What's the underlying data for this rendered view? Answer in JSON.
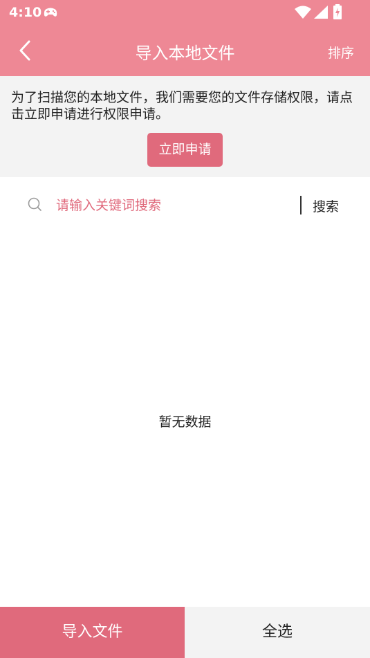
{
  "status_bar": {
    "time": "4:10",
    "icons": [
      "gamepad-icon",
      "wifi-icon",
      "signal-icon",
      "battery-icon"
    ]
  },
  "header": {
    "title": "导入本地文件",
    "sort_label": "排序",
    "back_icon": "chevron-left-icon"
  },
  "permission": {
    "message": "为了扫描您的本地文件，我们需要您的文件存储权限，请点击立即申请进行权限申请。",
    "button_label": "立即申请"
  },
  "search": {
    "placeholder": "请输入关键词搜索",
    "value": "",
    "button_label": "搜索",
    "icon": "search-icon"
  },
  "content": {
    "empty_text": "暂无数据"
  },
  "bottom_bar": {
    "import_label": "导入文件",
    "select_all_label": "全选"
  },
  "colors": {
    "header": "#ee8895",
    "accent": "#e06a7c",
    "panel": "#f3f3f3"
  }
}
